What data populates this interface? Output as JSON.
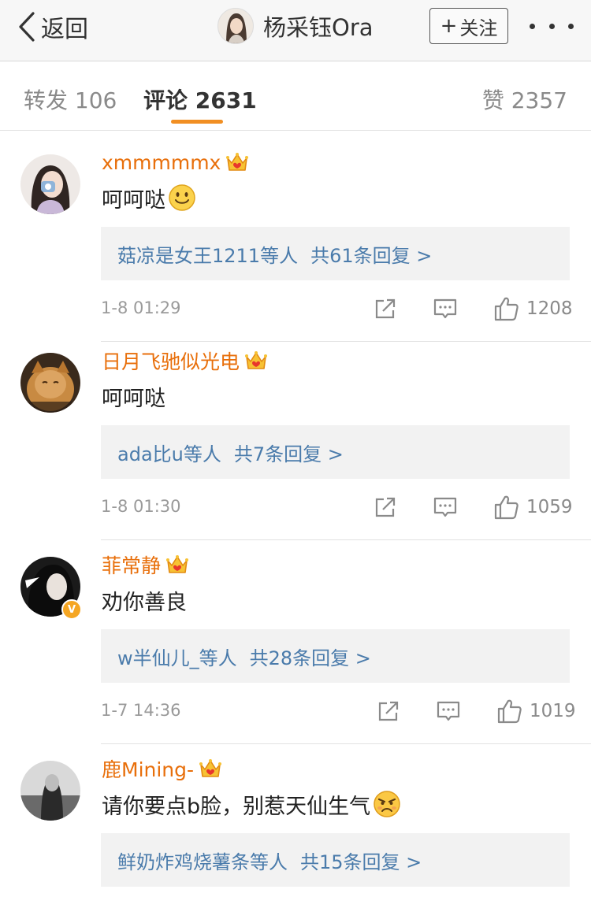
{
  "nav": {
    "back_label": "返回",
    "title": "杨采钰Ora",
    "follow_label": "关注",
    "follow_plus": "+"
  },
  "tabs": {
    "repost": "转发 106",
    "comment": "评论 2631",
    "like": "赞 2357"
  },
  "colors": {
    "accent": "#f18f23",
    "username": "#e86f0b",
    "reply_link": "#4a7bab"
  },
  "comments": [
    {
      "username": "xmmmmmx",
      "text": "呵呵哒",
      "emoji": "smile-emoji",
      "reply_users": "菇凉是女王1211等人",
      "reply_count": "共61条回复 >",
      "time": "1-8 01:29",
      "likes": "1208"
    },
    {
      "username": "日月飞驰似光电",
      "text": "呵呵哒",
      "reply_users": "ada比u等人",
      "reply_count": "共7条回复 >",
      "time": "1-8 01:30",
      "likes": "1059"
    },
    {
      "username": "菲常静",
      "text": "劝你善良",
      "reply_users": "w半仙儿_等人",
      "reply_count": "共28条回复 >",
      "time": "1-7 14:36",
      "likes": "1019"
    },
    {
      "username": "鹿Mining-",
      "text": "请你要点b脸，别惹天仙生气",
      "emoji": "angry-emoji",
      "reply_users": "鲜奶炸鸡烧薯条等人",
      "reply_count": "共15条回复 >"
    }
  ]
}
